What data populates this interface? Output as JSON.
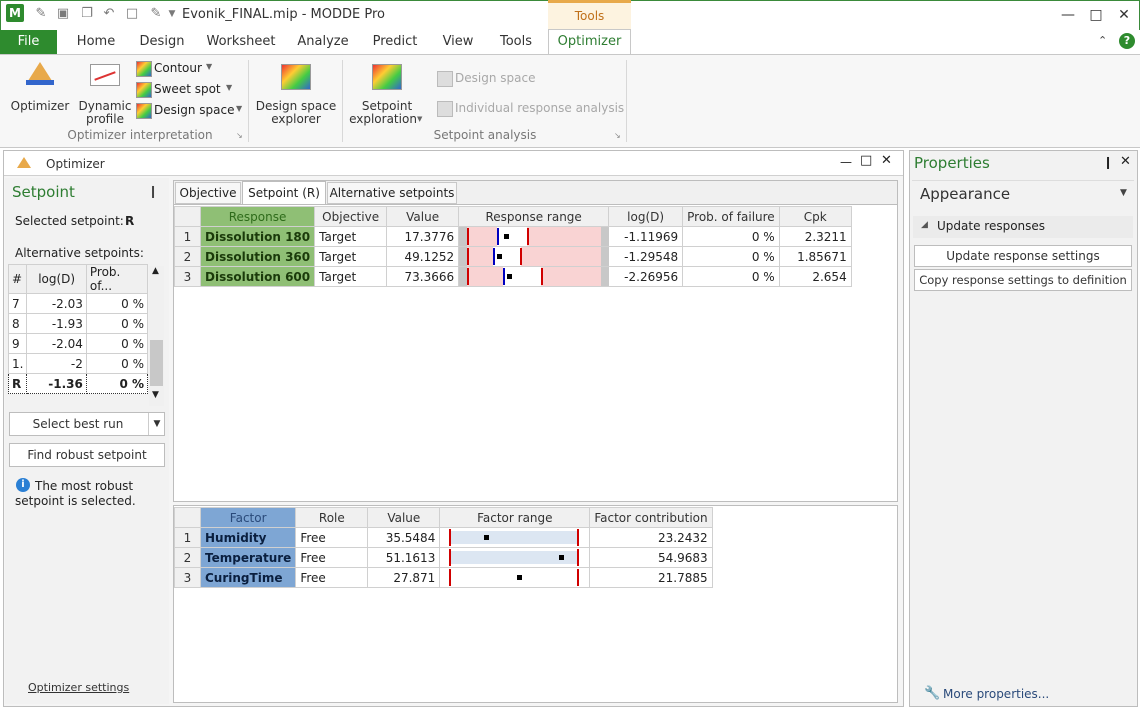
{
  "window": {
    "title": "Evonik_FINAL.mip - MODDE Pro",
    "app_icon_letter": "M",
    "contextual_tab_group": "Tools"
  },
  "ribbon_tabs": [
    "File",
    "Home",
    "Design",
    "Worksheet",
    "Analyze",
    "Predict",
    "View",
    "Tools",
    "Optimizer"
  ],
  "ribbon": {
    "optimizer_label": "Optimizer",
    "dynamic_profile_line1": "Dynamic",
    "dynamic_profile_line2": "profile",
    "contour_label": "Contour",
    "sweet_spot_label": "Sweet spot",
    "design_space_label": "Design space",
    "group1_label": "Optimizer interpretation",
    "ds_explorer_line1": "Design space",
    "ds_explorer_line2": "explorer",
    "setpoint_expl_line1": "Setpoint",
    "setpoint_expl_line2": "exploration",
    "design_space_disabled": "Design space",
    "individual_response_analysis": "Individual response analysis",
    "group2_label": "Setpoint analysis"
  },
  "optimizer_panel": {
    "title": "Optimizer",
    "setpoint_heading": "Setpoint",
    "selected_setpoint_label": "Selected setpoint:",
    "selected_setpoint_value": "R",
    "alt_setpoints_label": "Alternative setpoints:",
    "alt_columns": [
      "#",
      "log(D)",
      "Prob. of..."
    ],
    "alt_rows": [
      {
        "id": "7",
        "logd": "-2.03",
        "prob": "0 %"
      },
      {
        "id": "8",
        "logd": "-1.93",
        "prob": "0 %"
      },
      {
        "id": "9",
        "logd": "-2.04",
        "prob": "0 %"
      },
      {
        "id": "1.",
        "logd": "-2",
        "prob": "0 %"
      },
      {
        "id": "R",
        "logd": "-1.36",
        "prob": "0 %"
      }
    ],
    "select_best_run": "Select best run",
    "find_robust_setpoint": "Find robust setpoint",
    "info_text_line1": "The most robust",
    "info_text_line2": "setpoint is selected.",
    "optimizer_settings_link": "Optimizer settings",
    "subtabs": [
      "Objective",
      "Setpoint (R)",
      "Alternative setpoints"
    ]
  },
  "response_table": {
    "columns": [
      "Response",
      "Objective",
      "Value",
      "Response range",
      "log(D)",
      "Prob. of failure",
      "Cpk"
    ],
    "rows": [
      {
        "n": "1",
        "name": "Dissolution 180",
        "objective": "Target",
        "value": "17.3776",
        "logd": "-1.11969",
        "prob": "0 %",
        "cpk": "2.3211"
      },
      {
        "n": "2",
        "name": "Dissolution 360",
        "objective": "Target",
        "value": "49.1252",
        "logd": "-1.29548",
        "prob": "0 %",
        "cpk": "1.85671"
      },
      {
        "n": "3",
        "name": "Dissolution 600",
        "objective": "Target",
        "value": "73.3666",
        "logd": "-2.26956",
        "prob": "0 %",
        "cpk": "2.654"
      }
    ]
  },
  "factor_table": {
    "columns": [
      "Factor",
      "Role",
      "Value",
      "Factor range",
      "Factor contribution"
    ],
    "rows": [
      {
        "n": "1",
        "name": "Humidity",
        "role": "Free",
        "value": "35.5484",
        "contribution": "23.2432"
      },
      {
        "n": "2",
        "name": "Temperature",
        "role": "Free",
        "value": "51.1613",
        "contribution": "54.9683"
      },
      {
        "n": "3",
        "name": "CuringTime",
        "role": "Free",
        "value": "27.871",
        "contribution": "21.7885"
      }
    ]
  },
  "properties": {
    "title": "Properties",
    "appearance": "Appearance",
    "update_responses": "Update responses",
    "update_response_settings": "Update response settings",
    "copy_response_settings": "Copy response settings to definition",
    "more_properties": "More properties..."
  },
  "colors": {
    "file_tab": "#2e8b2e",
    "response_green": "#8fbf75",
    "factor_blue": "#7ea6d4",
    "range_pink": "#f9d3d3",
    "limit_red": "#d00000",
    "target_blue": "#0000c0"
  }
}
